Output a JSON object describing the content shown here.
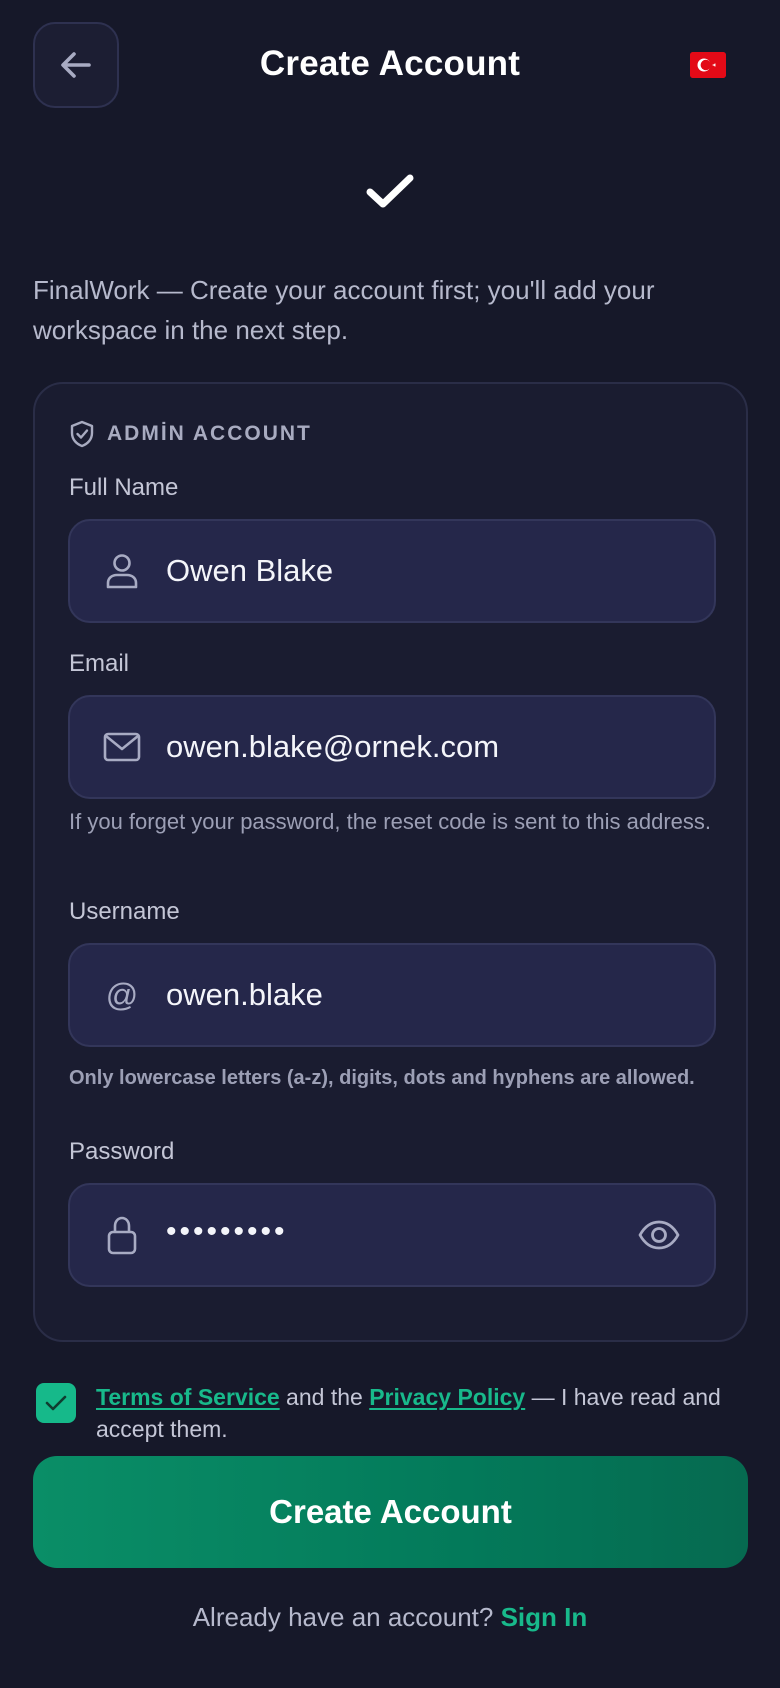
{
  "header": {
    "title": "Create Account",
    "back_icon": "arrow-left-icon",
    "language_flag": "turkish-flag-icon"
  },
  "intro": "FinalWork — Create your account first; you'll add your workspace in the next step.",
  "card": {
    "section_label": "ADMİN ACCOUNT",
    "fields": {
      "full_name": {
        "label": "Full Name",
        "value": "Owen Blake",
        "icon": "user-icon"
      },
      "email": {
        "label": "Email",
        "value": "owen.blake@ornek.com",
        "icon": "mail-icon",
        "hint": "If you forget your password, the reset code is sent to this address."
      },
      "username": {
        "label": "Username",
        "value": "owen.blake",
        "icon": "at-icon",
        "icon_glyph": "@",
        "hint": "Only lowercase letters (a-z), digits, dots and hyphens are allowed."
      },
      "password": {
        "label": "Password",
        "value": "•••••••••",
        "icon": "lock-icon",
        "toggle_icon": "eye-icon"
      }
    }
  },
  "terms": {
    "checked": true,
    "tos_link": "Terms of Service",
    "middle": " and the ",
    "privacy_link": "Privacy Policy",
    "suffix": " — I have read and accept them."
  },
  "submit_label": "Create Account",
  "footer": {
    "prompt": "Already have an account? ",
    "link": "Sign In"
  },
  "colors": {
    "background": "#161829",
    "card": "#1a1c30",
    "input": "#25274a",
    "accent": "#18b98b",
    "button": "#037a5a"
  }
}
